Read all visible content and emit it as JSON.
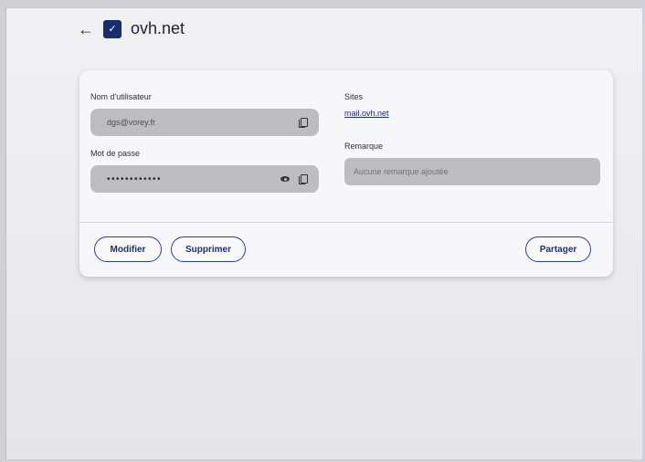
{
  "header": {
    "back_icon": "arrow-left-icon",
    "logo_text": "✓",
    "title": "ovh.net"
  },
  "fields": {
    "username": {
      "label": "Nom d'utilisateur",
      "value": "dgs@vorey.fr"
    },
    "password": {
      "label": "Mot de passe",
      "value": "••••••••••••"
    },
    "sites": {
      "label": "Sites",
      "value": "mail.ovh.net"
    },
    "remark": {
      "label": "Remarque",
      "placeholder": "Aucune remarque ajoutée"
    }
  },
  "actions": {
    "modify": "Modifier",
    "delete": "Supprimer",
    "share": "Partager"
  },
  "colors": {
    "accent": "#1e2f74",
    "field_bg": "#bdbdc1"
  }
}
